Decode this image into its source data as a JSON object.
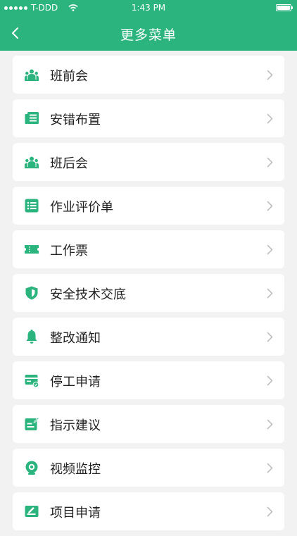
{
  "status_bar": {
    "carrier": "T-DDD",
    "time": "1:43 PM",
    "battery_level": 1.0
  },
  "nav": {
    "title": "更多菜单"
  },
  "colors": {
    "brand": "#2bb47e",
    "background": "#f2f2f2",
    "chevron": "#bfbfbf"
  },
  "menu": [
    {
      "label": "班前会",
      "icon": "team-icon"
    },
    {
      "label": "安错布置",
      "icon": "newspaper-icon"
    },
    {
      "label": "班后会",
      "icon": "team-icon"
    },
    {
      "label": "作业评价单",
      "icon": "list-icon"
    },
    {
      "label": "工作票",
      "icon": "ticket-icon"
    },
    {
      "label": "安全技术交底",
      "icon": "shield-icon"
    },
    {
      "label": "整改通知",
      "icon": "bell-icon"
    },
    {
      "label": "停工申请",
      "icon": "card-check-icon"
    },
    {
      "label": "指示建议",
      "icon": "edit-note-icon"
    },
    {
      "label": "视频监控",
      "icon": "camera-icon"
    },
    {
      "label": "项目申请",
      "icon": "edit-card-icon"
    }
  ]
}
